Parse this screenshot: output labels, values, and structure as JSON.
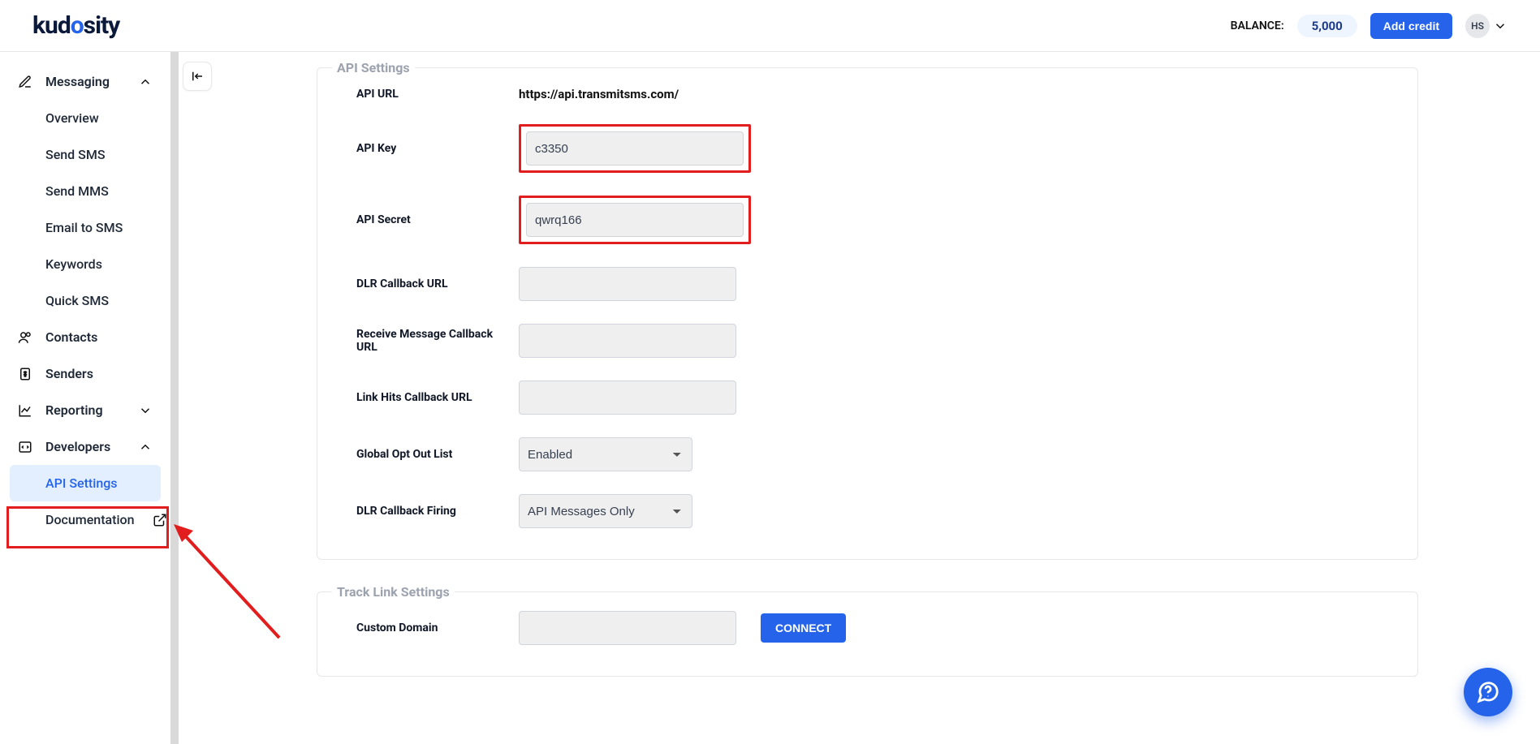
{
  "header": {
    "logo_text": "kudosity",
    "balance_label": "BALANCE:",
    "balance_value": "5,000",
    "add_credit_label": "Add credit",
    "avatar_initials": "HS"
  },
  "sidebar": {
    "messaging": {
      "label": "Messaging",
      "items": [
        "Overview",
        "Send SMS",
        "Send MMS",
        "Email to SMS",
        "Keywords",
        "Quick SMS"
      ]
    },
    "contacts": "Contacts",
    "senders": "Senders",
    "reporting": "Reporting",
    "developers": {
      "label": "Developers",
      "items": [
        "API Settings",
        "Documentation"
      ]
    }
  },
  "api_settings": {
    "legend": "API Settings",
    "rows": {
      "api_url_label": "API URL",
      "api_url_value": "https://api.transmitsms.com/",
      "api_key_label": "API Key",
      "api_key_value": "c3350",
      "api_secret_label": "API Secret",
      "api_secret_value": "qwrq166",
      "dlr_cb_label": "DLR Callback URL",
      "dlr_cb_value": "",
      "recv_cb_label": "Receive Message Callback URL",
      "recv_cb_value": "",
      "link_cb_label": "Link Hits Callback URL",
      "link_cb_value": "",
      "optout_label": "Global Opt Out List",
      "optout_value": "Enabled",
      "dlr_fire_label": "DLR Callback Firing",
      "dlr_fire_value": "API Messages Only"
    }
  },
  "track_link": {
    "legend": "Track Link Settings",
    "custom_domain_label": "Custom Domain",
    "custom_domain_value": "",
    "connect_label": "CONNECT"
  }
}
